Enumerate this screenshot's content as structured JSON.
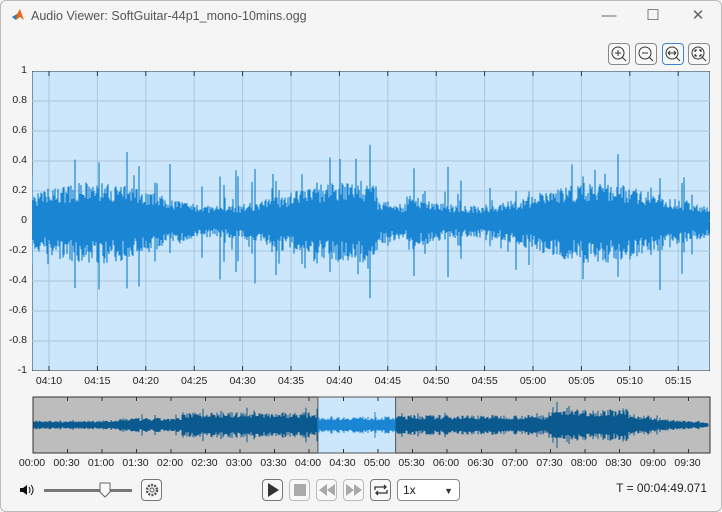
{
  "window": {
    "title": "Audio Viewer: SoftGuitar-44p1_mono-10mins.ogg",
    "minimize": "—",
    "maximize": "☐",
    "close": "✕"
  },
  "toolbar": {
    "zoom_in": "zoom-in",
    "zoom_out": "zoom-out",
    "zoom_x": "zoom-horizontal",
    "zoom_reset": "restore-view"
  },
  "main_plot": {
    "yticks": [
      "1",
      "0.8",
      "0.6",
      "0.4",
      "0.2",
      "0",
      "-0.2",
      "-0.4",
      "-0.6",
      "-0.8",
      "-1"
    ],
    "xticks": [
      "04:10",
      "04:15",
      "04:20",
      "04:25",
      "04:30",
      "04:35",
      "04:40",
      "04:45",
      "04:50",
      "04:55",
      "05:00",
      "05:05",
      "05:10",
      "05:15"
    ],
    "bg": "#cce6fb",
    "wave": "#1a86d3"
  },
  "overview": {
    "xticks": [
      "00:00",
      "00:30",
      "01:00",
      "01:30",
      "02:00",
      "02:30",
      "03:00",
      "03:30",
      "04:00",
      "04:30",
      "05:00",
      "05:30",
      "06:00",
      "06:30",
      "07:00",
      "07:30",
      "08:00",
      "08:30",
      "09:00",
      "09:30"
    ],
    "selection_start_s": 248.3,
    "selection_end_s": 316,
    "total_s": 590,
    "bg": "#bdbdbd",
    "wave": "#0b5a8f"
  },
  "controls": {
    "volume": 0.69,
    "speed": "1x",
    "time_readout": "T = 00:04:49.071"
  }
}
